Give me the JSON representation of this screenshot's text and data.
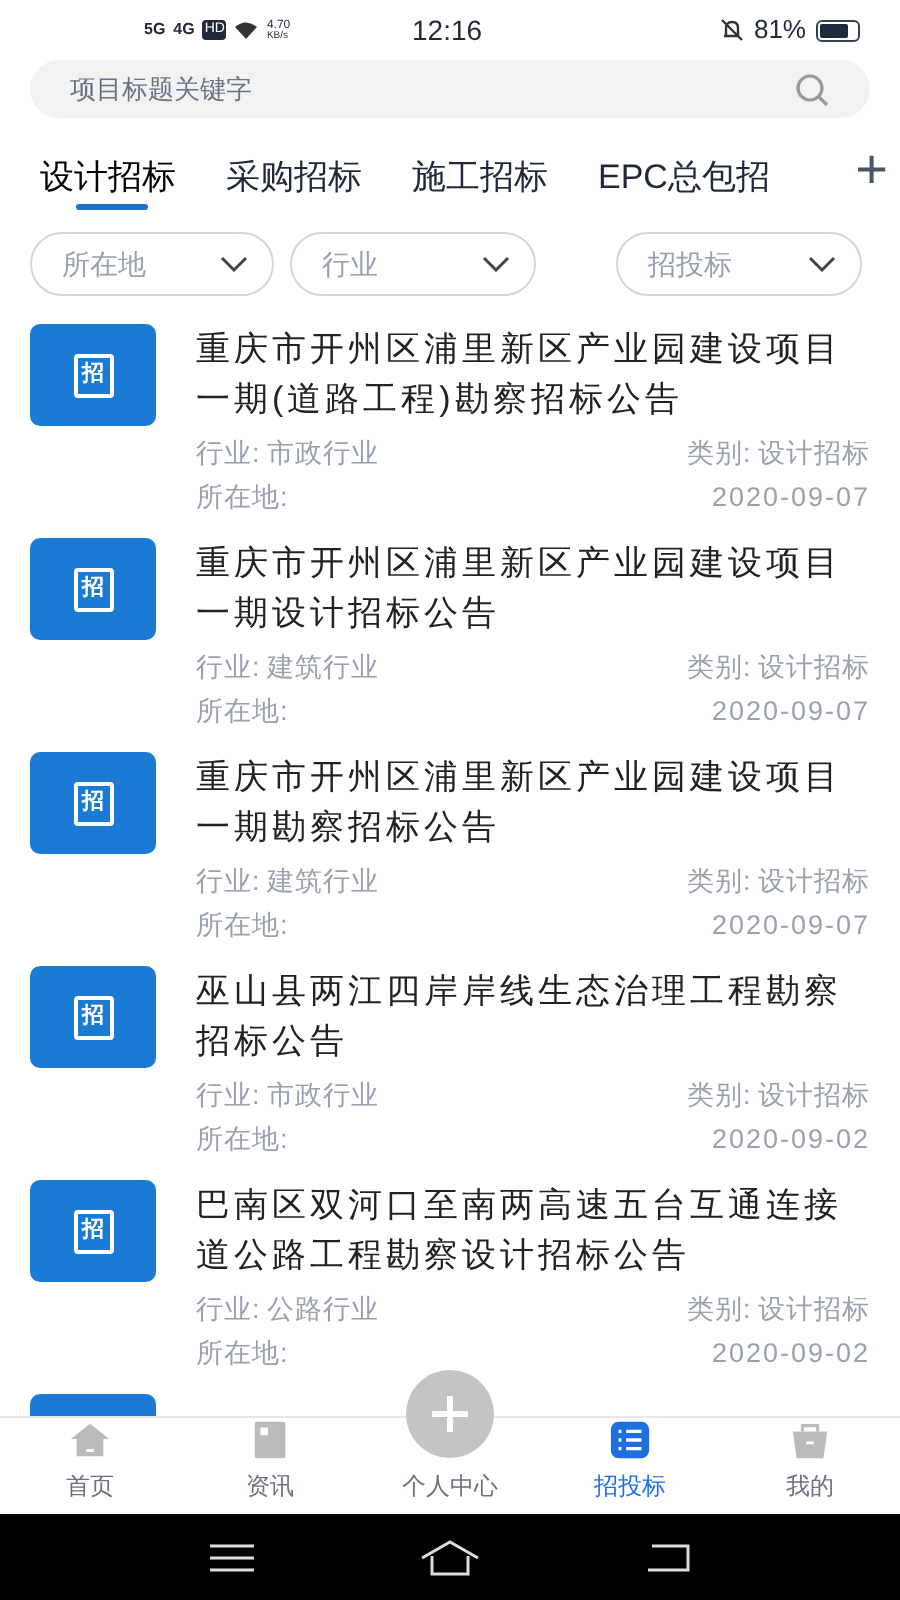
{
  "status_bar": {
    "network_1": "5G",
    "network_2": "4G",
    "hd": "HD",
    "speed": "4.70",
    "speed_unit": "KB/s",
    "time": "12:16",
    "battery": "81%"
  },
  "search": {
    "placeholder": "项目标题关键字"
  },
  "tabs": [
    {
      "label": "设计招标",
      "selected": true
    },
    {
      "label": "采购招标",
      "selected": false
    },
    {
      "label": "施工招标",
      "selected": false
    },
    {
      "label": "EPC总包招",
      "selected": false
    }
  ],
  "add_tab": "+",
  "filters": [
    {
      "label": "所在地"
    },
    {
      "label": "行业"
    },
    {
      "label": "招投标"
    }
  ],
  "items": [
    {
      "icon_text": "招",
      "title": "重庆市开州区浦里新区产业园建设项目一期(道路工程)勘察招标公告",
      "industry_label": "行业:",
      "industry": "市政行业",
      "category_label": "类别:",
      "category": "设计招标",
      "location_label": "所在地:",
      "date": "2020-09-07"
    },
    {
      "icon_text": "招",
      "title": "重庆市开州区浦里新区产业园建设项目一期设计招标公告",
      "industry_label": "行业:",
      "industry": "建筑行业",
      "category_label": "类别:",
      "category": "设计招标",
      "location_label": "所在地:",
      "date": "2020-09-07"
    },
    {
      "icon_text": "招",
      "title": "重庆市开州区浦里新区产业园建设项目一期勘察招标公告",
      "industry_label": "行业:",
      "industry": "建筑行业",
      "category_label": "类别:",
      "category": "设计招标",
      "location_label": "所在地:",
      "date": "2020-09-07"
    },
    {
      "icon_text": "招",
      "title": "巫山县两江四岸岸线生态治理工程勘察招标公告",
      "industry_label": "行业:",
      "industry": "市政行业",
      "category_label": "类别:",
      "category": "设计招标",
      "location_label": "所在地:",
      "date": "2020-09-02"
    },
    {
      "icon_text": "招",
      "title": "巴南区双河口至南两高速五台互通连接道公路工程勘察设计招标公告",
      "industry_label": "行业:",
      "industry": "公路行业",
      "category_label": "类别:",
      "category": "设计招标",
      "location_label": "所在地:",
      "date": "2020-09-02"
    }
  ],
  "partial_item": {
    "kind": "notice"
  },
  "nav": [
    {
      "kind": "home",
      "label": "首页",
      "selected": false
    },
    {
      "kind": "news",
      "label": "资讯",
      "selected": false
    },
    {
      "kind": "center",
      "label": "个人中心",
      "selected": false
    },
    {
      "kind": "list",
      "label": "招投标",
      "selected": true
    },
    {
      "kind": "bag",
      "label": "我的",
      "selected": false
    }
  ]
}
